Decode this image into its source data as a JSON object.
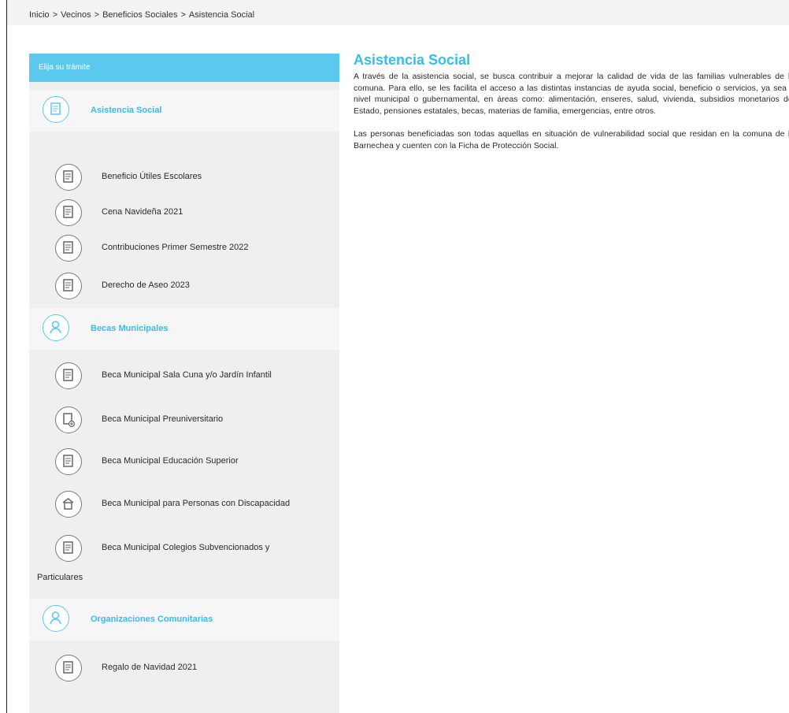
{
  "breadcrumb": {
    "items": [
      "Inicio",
      "Vecinos",
      "Beneficios Sociales",
      "Asistencia Social"
    ],
    "separator": ">"
  },
  "sidebar": {
    "header": "Elija su trámite",
    "accent_color": "#5bc8ee",
    "categories": [
      {
        "label": "Asistencia Social",
        "icon": "document-icon",
        "items": [
          {
            "label": "Beneficio Útiles Escolares",
            "icon": "form-icon"
          },
          {
            "label": "Cena Navideña 2021",
            "icon": "form-icon"
          },
          {
            "label": "Contribuciones Primer Semestre 2022",
            "icon": "form-icon"
          },
          {
            "label": "Derecho de Aseo 2023",
            "icon": "form-icon"
          }
        ]
      },
      {
        "label": "Becas Municipales",
        "icon": "person-icon",
        "items": [
          {
            "label": "Beca Municipal Sala Cuna y/o Jardín Infantil",
            "icon": "form-icon"
          },
          {
            "label": "Beca Municipal Preuniversitario",
            "icon": "clipboard-add-icon"
          },
          {
            "label": "Beca Municipal Educación Superior",
            "icon": "form-icon"
          },
          {
            "label": "Beca Municipal para Personas con Discapacidad",
            "icon": "building-icon"
          },
          {
            "label": "Beca Municipal Colegios Subvencionados y",
            "continuation": "Particulares",
            "icon": "form-icon"
          }
        ]
      },
      {
        "label": "Organizaciones Comunitarias",
        "icon": "person-icon",
        "items": [
          {
            "label": "Regalo de Navidad 2021",
            "icon": "form-icon"
          }
        ]
      }
    ]
  },
  "main": {
    "title": "Asistencia Social",
    "paragraph1": "A través de la asistencia social, se busca contribuir a mejorar la calidad de vida de las familias vulnerables de la comuna. Para ello, se les facilita el acceso a las distintas instancias de ayuda social, beneficio o servicios, ya sea a nivel municipal o gubernamental, en áreas como: alimentación, enseres, salud, vivienda, subsidios monetarios del Estado, pensiones estatales, becas, materias de familia, emergencias, entre otros.",
    "paragraph2": "Las personas beneficiadas son todas aquellas en situación de vulnerabilidad social que residan en la comuna de lo Barnechea y cuenten con la Ficha de Protección Social."
  }
}
